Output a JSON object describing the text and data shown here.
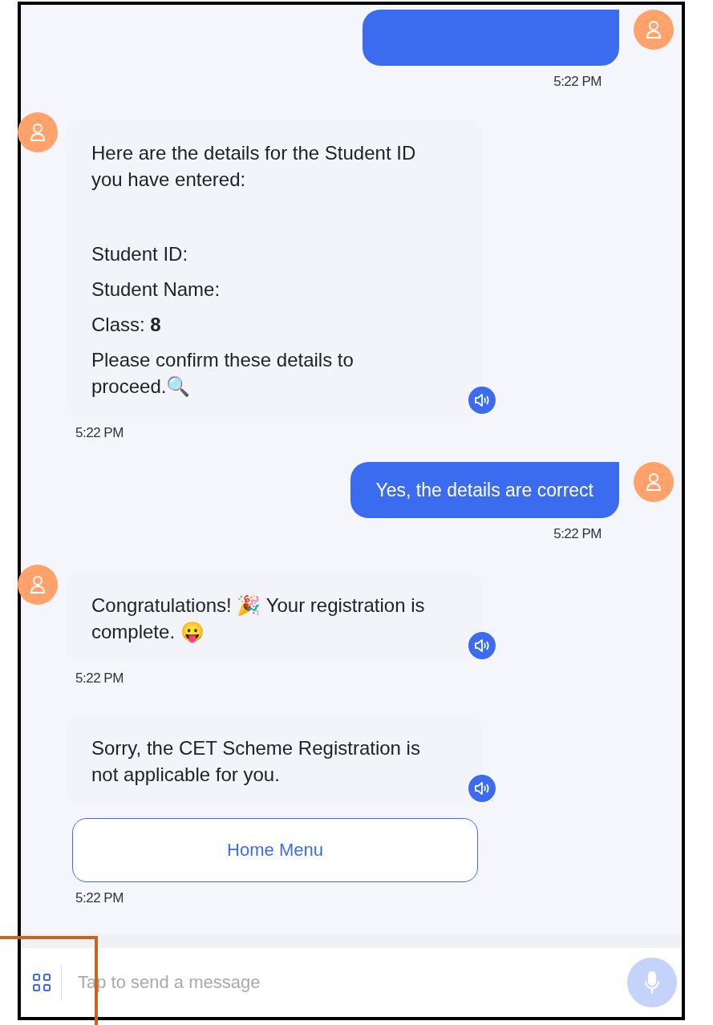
{
  "messages": [
    {
      "kind": "user",
      "time": "5:22 PM",
      "show_avatar": true
    },
    {
      "kind": "bot",
      "show_avatar": true,
      "lines": [
        "Here are the details for the Student ID you have entered:",
        "Student ID:",
        "Student Name:",
        "Class: **8**",
        "Please confirm these details to proceed.🔍"
      ],
      "time": "5:22 PM"
    },
    {
      "kind": "user",
      "text": "Yes, the details are correct",
      "time": "5:22 PM",
      "show_avatar": true
    },
    {
      "kind": "bot",
      "show_avatar": true,
      "lines": [
        "Congratulations! 🎉 Your registration is complete. 😛"
      ],
      "time": "5:22 PM"
    },
    {
      "kind": "bot",
      "show_avatar": false,
      "lines": [
        "Sorry, the CET Scheme Registration is not applicable for you."
      ],
      "buttons": [
        "Home Menu"
      ],
      "time": "5:22 PM"
    }
  ],
  "composer": {
    "placeholder": "Tap to send a message"
  }
}
